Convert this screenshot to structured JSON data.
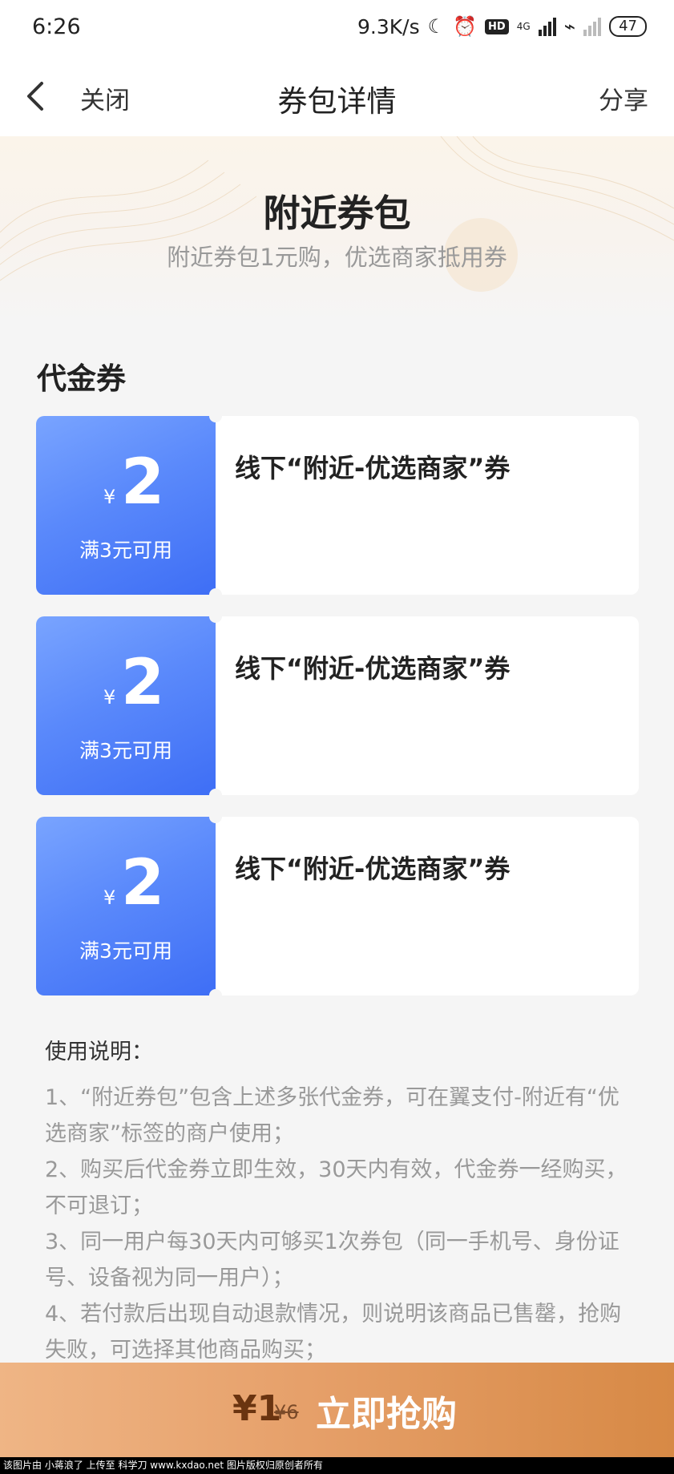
{
  "status_bar": {
    "time": "6:26",
    "speed": "9.3K/s",
    "network_label": "4G",
    "hd_label": "HD",
    "battery": "47"
  },
  "nav": {
    "back_icon": "chevron-left-icon",
    "close_label": "关闭",
    "title": "券包详情",
    "share_label": "分享"
  },
  "hero": {
    "title": "附近券包",
    "subtitle": "附近券包1元购，优选商家抵用券"
  },
  "section": {
    "title": "代金券"
  },
  "coupons": [
    {
      "currency": "¥",
      "value": "2",
      "condition": "满3元可用",
      "name": "线下“附近-优选商家”券"
    },
    {
      "currency": "¥",
      "value": "2",
      "condition": "满3元可用",
      "name": "线下“附近-优选商家”券"
    },
    {
      "currency": "¥",
      "value": "2",
      "condition": "满3元可用",
      "name": "线下“附近-优选商家”券"
    }
  ],
  "instructions": {
    "title": "使用说明：",
    "items": [
      "1、“附近券包”包含上述多张代金券，可在翼支付-附近有“优选商家”标签的商户使用；",
      "2、购买后代金券立即生效，30天内有效，代金券一经购买，不可退订；",
      "3、同一用户每30天内可够买1次券包（同一手机号、身份证号、设备视为同一用户）；",
      "4、若付款后出现自动退款情况，则说明该商品已售罄，抢购失败，可选择其他商品购买；"
    ]
  },
  "buy": {
    "price": "¥1",
    "original_price": "¥6",
    "label": "立即抢购"
  },
  "watermark": "该图片由 小蒋浪了 上传至 科学刀 www.kxdao.net 图片版权归原创者所有",
  "colors": {
    "coupon_gradient_start": "#79a4ff",
    "coupon_gradient_end": "#3e6ef5",
    "buy_gradient_start": "#efb585",
    "buy_gradient_end": "#d78945",
    "background": "#f5f5f5"
  }
}
